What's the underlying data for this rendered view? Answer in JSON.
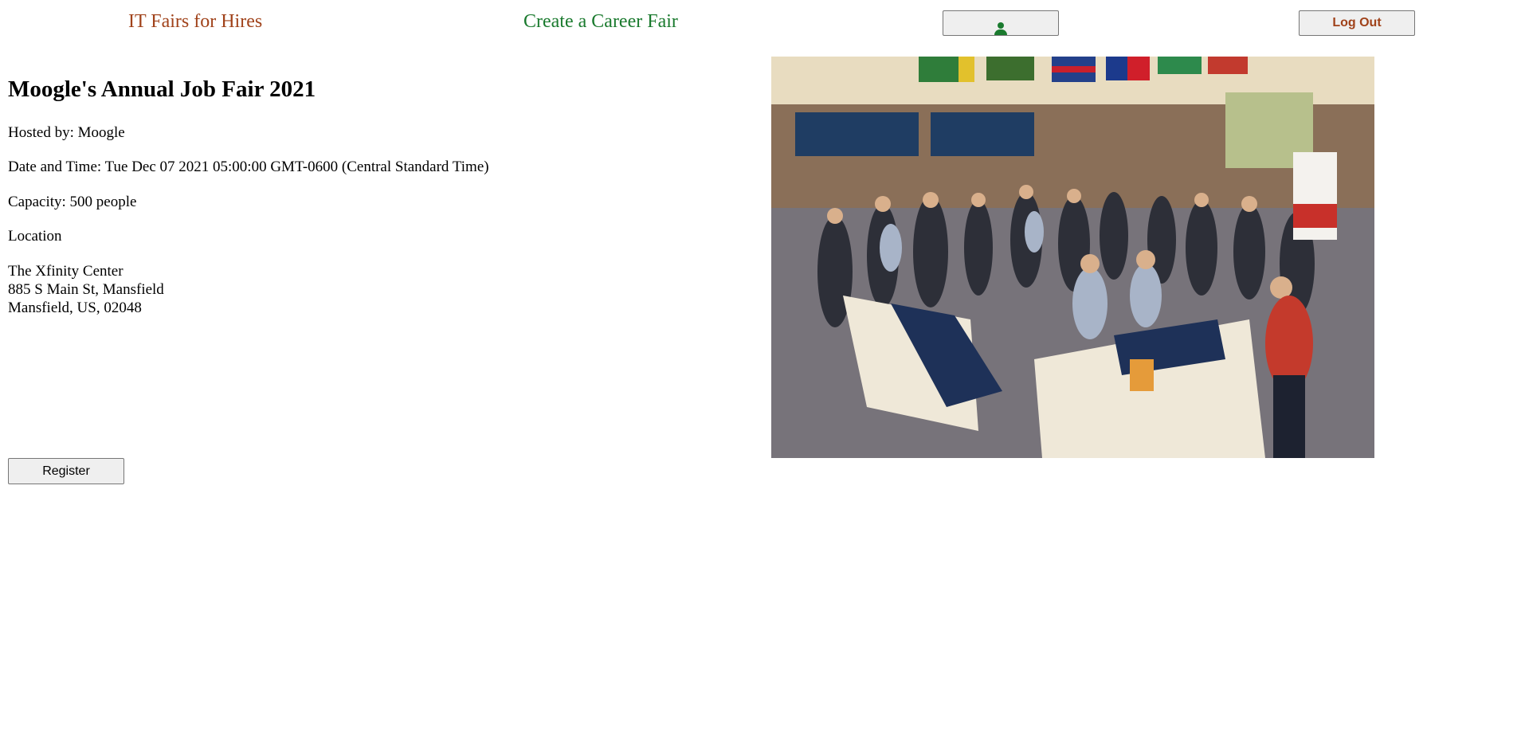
{
  "nav": {
    "brand_label": "IT Fairs for Hires",
    "create_label": "Create a Career Fair",
    "profile_icon": "person-icon",
    "logout_label": "Log Out"
  },
  "fair": {
    "title": "Moogle's Annual Job Fair 2021",
    "hosted_by": "Hosted by: Moogle",
    "date_time": "Date and Time: Tue Dec 07 2021 05:00:00 GMT-0600 (Central Standard Time)",
    "capacity": "Capacity: 500 people",
    "location_heading": "Location",
    "address": {
      "venue": "The Xfinity Center",
      "street": "885 S Main St, Mansfield",
      "city_line": "Mansfield, US, 02048"
    }
  },
  "register_label": "Register",
  "colors": {
    "brand_link": "#a0421a",
    "create_link": "#1a7a2e",
    "profile_icon": "#1a7a2e",
    "logout_text": "#a0421a"
  }
}
